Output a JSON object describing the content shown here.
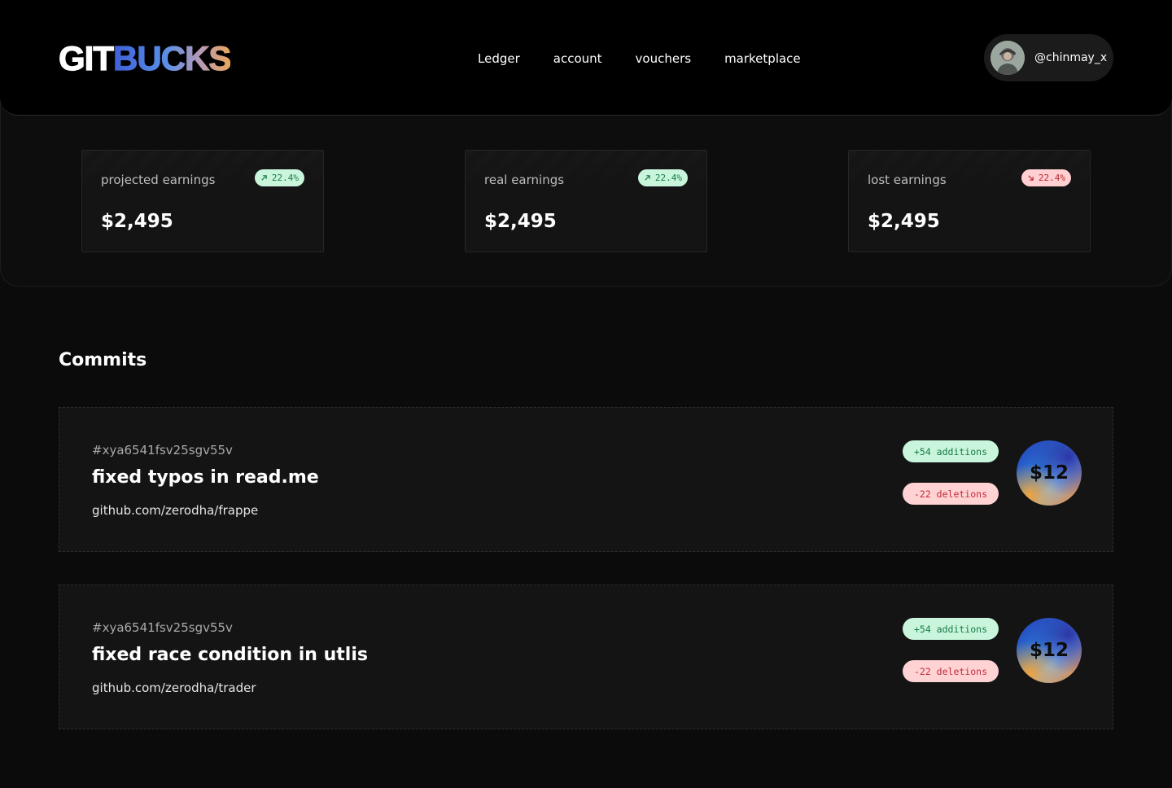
{
  "header": {
    "logo": {
      "part1": "GIT",
      "part2": "BUCKS"
    },
    "nav": [
      "Ledger",
      "account",
      "vouchers",
      "marketplace"
    ],
    "user": {
      "username": "@chinmay_x"
    }
  },
  "stats": [
    {
      "label": "projected earnings",
      "value": "$2,495",
      "trend": "22.4%",
      "direction": "up"
    },
    {
      "label": "real earnings",
      "value": "$2,495",
      "trend": "22.4%",
      "direction": "up"
    },
    {
      "label": "lost earnings",
      "value": "$2,495",
      "trend": "22.4%",
      "direction": "down"
    }
  ],
  "commits_section": {
    "title": "Commits",
    "items": [
      {
        "hash": "#xya6541fsv25sgv55v",
        "message": "fixed typos in read.me",
        "repo": "github.com/zerodha/frappe",
        "additions": "+54 additions",
        "deletions": "-22 deletions",
        "amount": "$12"
      },
      {
        "hash": "#xya6541fsv25sgv55v",
        "message": "fixed race condition in utlis",
        "repo": "github.com/zerodha/trader",
        "additions": "+54 additions",
        "deletions": "-22 deletions",
        "amount": "$12"
      }
    ]
  },
  "colors": {
    "background": "#0b0b0b",
    "header": "#000000",
    "card": "#141414",
    "up_badge": "#c8f5dc",
    "down_badge": "#ffcfd1",
    "coin_blue": "#2336b8",
    "coin_orange": "#f0a23c"
  }
}
